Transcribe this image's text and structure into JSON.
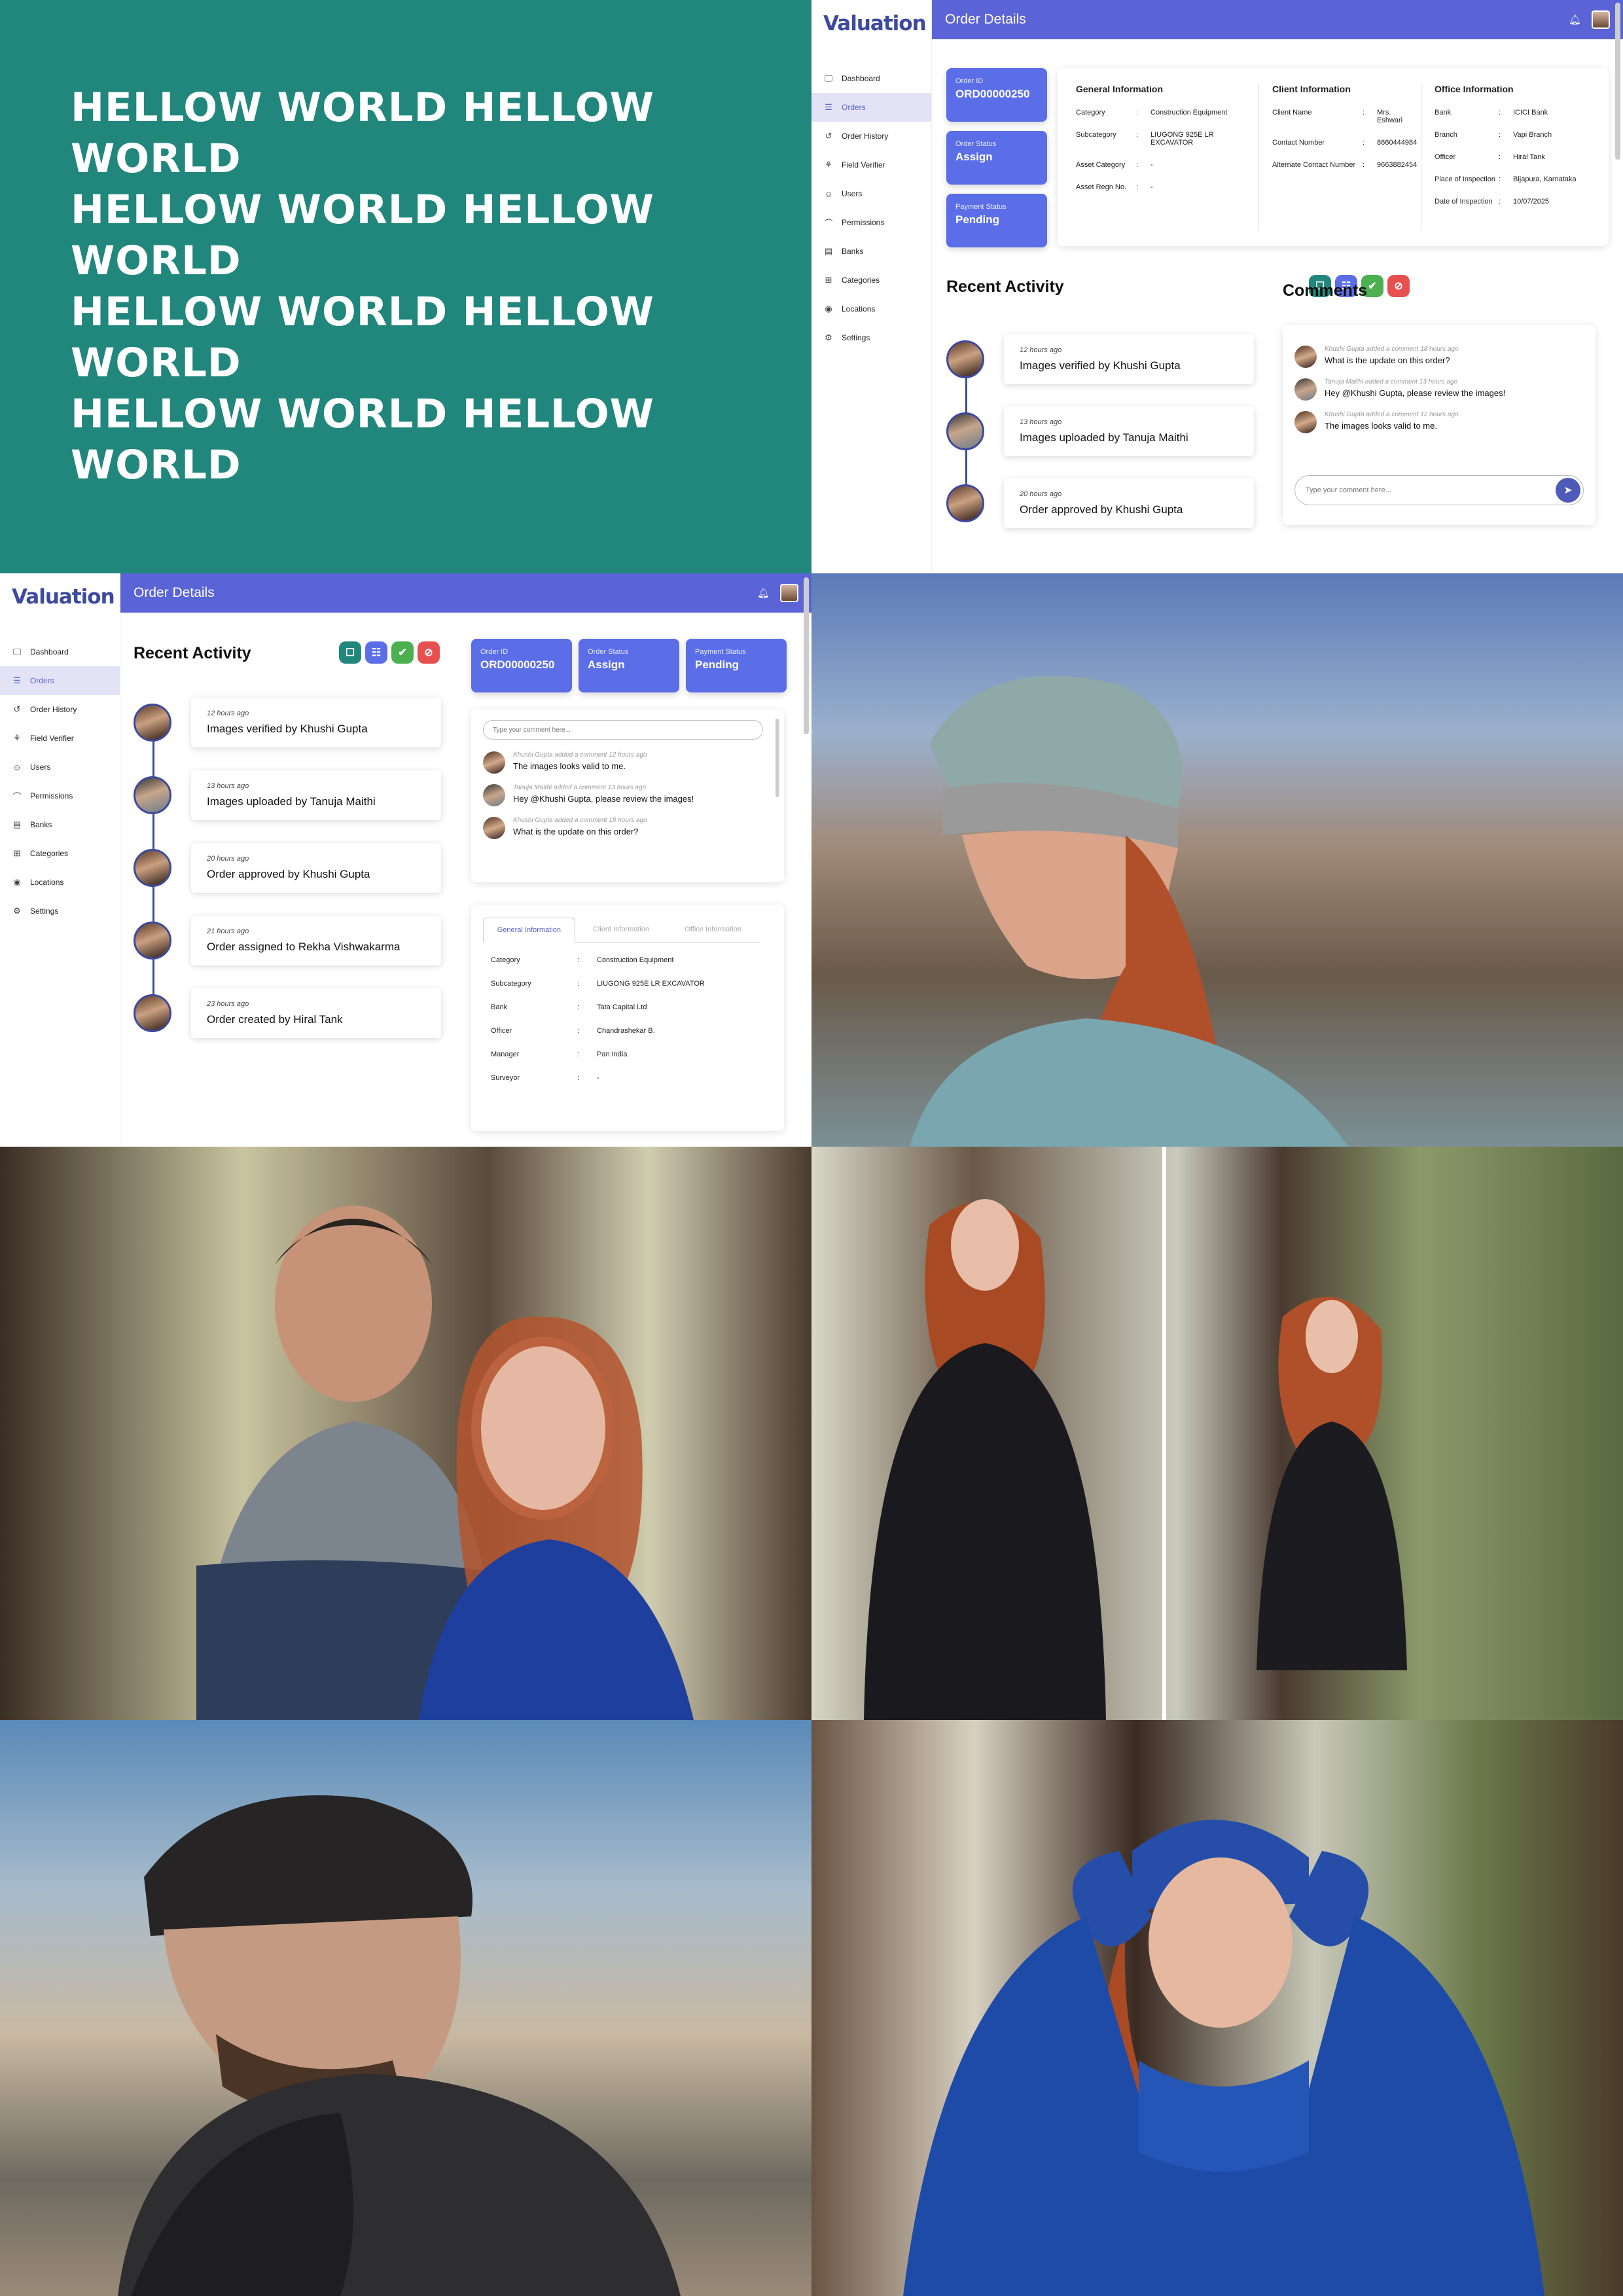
{
  "banner": {
    "lines": [
      "HELLOW WORLD HELLOW WORLD",
      "HELLOW WORLD HELLOW WORLD",
      "HELLOW WORLD HELLOW WORLD",
      "HELLOW WORLD HELLOW WORLD"
    ]
  },
  "app": {
    "logo": "Valuation",
    "page_title": "Order Details",
    "nav": [
      {
        "label": "Dashboard",
        "icon": "monitor-icon"
      },
      {
        "label": "Orders",
        "icon": "clipboard-icon"
      },
      {
        "label": "Order History",
        "icon": "history-icon"
      },
      {
        "label": "Field Verifier",
        "icon": "bike-icon"
      },
      {
        "label": "Users",
        "icon": "users-icon"
      },
      {
        "label": "Permissions",
        "icon": "key-icon"
      },
      {
        "label": "Banks",
        "icon": "bank-icon"
      },
      {
        "label": "Categories",
        "icon": "grid-icon"
      },
      {
        "label": "Locations",
        "icon": "pin-icon"
      },
      {
        "label": "Settings",
        "icon": "gear-icon"
      }
    ],
    "active_nav": "Orders",
    "pills": [
      {
        "label": "Order ID",
        "value": "ORD00000250"
      },
      {
        "label": "Order Status",
        "value": "Assign"
      },
      {
        "label": "Payment Status",
        "value": "Pending"
      }
    ],
    "general_info": {
      "title": "General Information",
      "rows": [
        {
          "k": "Category",
          "v": "Construction Equipment"
        },
        {
          "k": "Subcategory",
          "v": "LIUGONG 925E LR EXCAVATOR"
        },
        {
          "k": "Asset Category",
          "v": "-"
        },
        {
          "k": "Asset Regn No.",
          "v": "-"
        }
      ]
    },
    "client_info": {
      "title": "Client Information",
      "rows": [
        {
          "k": "Client Name",
          "v": "Mrs. Eshwari"
        },
        {
          "k": "Contact Number",
          "v": "8660444984"
        },
        {
          "k": "Alternate Contact Number",
          "v": "9663882454"
        }
      ]
    },
    "office_info": {
      "title": "Office Information",
      "rows": [
        {
          "k": "Bank",
          "v": "ICICI Bank"
        },
        {
          "k": "Branch",
          "v": "Vapi Branch"
        },
        {
          "k": "Officer",
          "v": "Hiral Tank"
        },
        {
          "k": "Place of Inspection",
          "v": "Bijapura, Karnataka"
        },
        {
          "k": "Date of Inspection",
          "v": "10/07/2025"
        }
      ]
    },
    "recent_activity_title": "Recent Activity",
    "comments_title": "Comments",
    "activity": [
      {
        "time": "12 hours ago",
        "msg": "Images verified by Khushi Gupta"
      },
      {
        "time": "13 hours ago",
        "msg": "Images uploaded by Tanuja Maithi"
      },
      {
        "time": "20 hours ago",
        "msg": "Order approved by Khushi Gupta"
      },
      {
        "time": "21 hours ago",
        "msg": "Order assigned to Rekha Vishwakarma"
      },
      {
        "time": "23 hours ago",
        "msg": "Order created by Hiral Tank"
      }
    ],
    "comments": [
      {
        "who": "Khushi Gupta",
        "verb": "added a comment 18 hours ago",
        "text": "What is the update on this order?"
      },
      {
        "who": "Tanuja Maithi",
        "verb": "added a comment 13 hours ago",
        "text": "Hey @Khushi Gupta, please review the images!"
      },
      {
        "who": "Khushi Gupta",
        "verb": "added a comment 12 hours ago",
        "text": "The images looks valid to me."
      }
    ],
    "comments_rev": [
      {
        "who": "Khushi Gupta",
        "verb": "added a comment 12 hours ago",
        "text": "The images looks valid to me."
      },
      {
        "who": "Tanuja Maithi",
        "verb": "added a comment 13 hours ago",
        "text": "Hey @Khushi Gupta, please review the images!"
      },
      {
        "who": "Khushi Gupta",
        "verb": "added a comment 18 hours ago",
        "text": "What is the update on this order?"
      }
    ],
    "comment_placeholder": "Type your comment here...",
    "tabs": [
      "General Information",
      "Client Information",
      "Office Information"
    ],
    "tab_rows": [
      {
        "k": "Category",
        "v": "Construction Equipment"
      },
      {
        "k": "Subcategory",
        "v": "LIUGONG 925E LR EXCAVATOR"
      },
      {
        "k": "Bank",
        "v": "Tata Capital Ltd"
      },
      {
        "k": "Officer",
        "v": "Chandrashekar B."
      },
      {
        "k": "Manager",
        "v": "Pan India"
      },
      {
        "k": "Surveyor",
        "v": "-"
      }
    ],
    "colors": {
      "accent": "#5b64d6",
      "pill": "#5b6ee8",
      "logo": "#3d4a9e",
      "teal": "#21877d"
    }
  }
}
